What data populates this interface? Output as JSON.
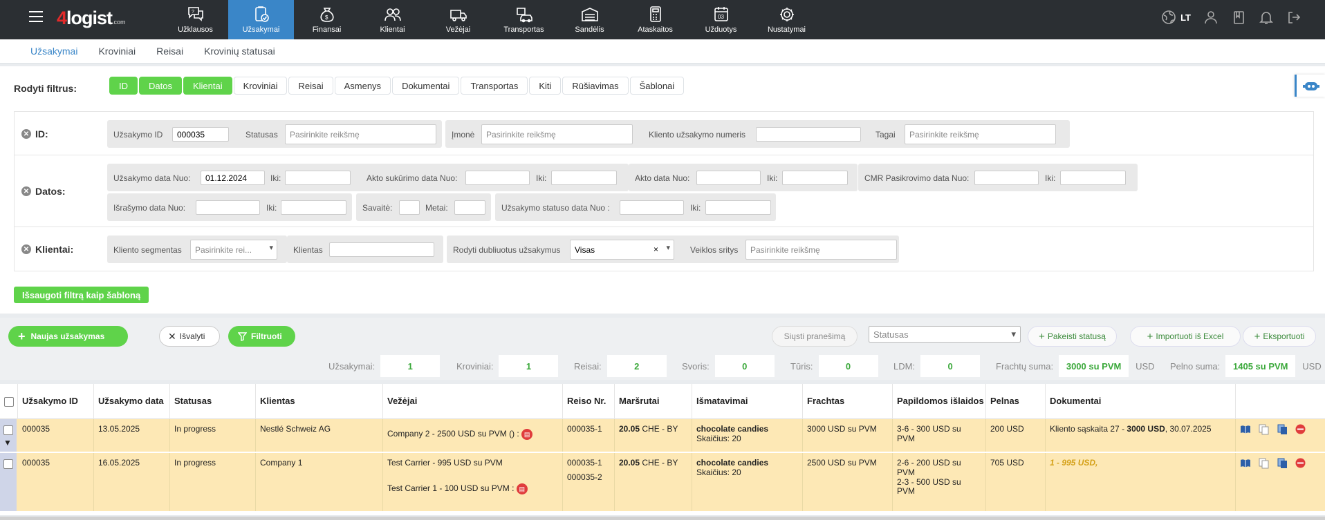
{
  "app": {
    "logo_main": "4",
    "logo_rest": "logist",
    "logo_domain": ".com",
    "language": "LT"
  },
  "nav": [
    {
      "label": "Užklausos",
      "icon": "inquiry-icon"
    },
    {
      "label": "Užsakymai",
      "icon": "orders-icon",
      "active": true
    },
    {
      "label": "Finansai",
      "icon": "money-bag-icon"
    },
    {
      "label": "Klientai",
      "icon": "users-icon"
    },
    {
      "label": "Vežėjai",
      "icon": "truck-icon"
    },
    {
      "label": "Transportas",
      "icon": "vehicles-icon"
    },
    {
      "label": "Sandėlis",
      "icon": "warehouse-icon"
    },
    {
      "label": "Ataskaitos",
      "icon": "calculator-icon"
    },
    {
      "label": "Užduotys",
      "icon": "calendar-icon"
    },
    {
      "label": "Nustatymai",
      "icon": "gear-icon"
    }
  ],
  "subnav": [
    "Užsakymai",
    "Kroviniai",
    "Reisai",
    "Krovinių statusai"
  ],
  "filters": {
    "show_label": "Rodyti filtrus:",
    "tabs": [
      "ID",
      "Datos",
      "Klientai",
      "Kroviniai",
      "Reisai",
      "Asmenys",
      "Dokumentai",
      "Transportas",
      "Kiti",
      "Rūšiavimas",
      "Šablonai"
    ],
    "id_group": {
      "label": "ID:",
      "order_id_label": "Užsakymo ID",
      "order_id_value": "000035",
      "status_label": "Statusas",
      "status_placeholder": "Pasirinkite reikšmę",
      "company_label": "Įmonė",
      "company_placeholder": "Pasirinkite reikšmę",
      "client_order_label": "Kliento užsakymo numeris",
      "tags_label": "Tagai",
      "tags_placeholder": "Pasirinkite reikšmę"
    },
    "dates_group": {
      "label": "Datos:",
      "order_date_label": "Užsakymo data Nuo:",
      "order_date_value": "01.12.2024",
      "to_label": "Iki:",
      "act_created_label": "Akto sukūrimo data Nuo:",
      "act_date_label": "Akto data Nuo:",
      "cmr_label": "CMR Pasikrovimo data Nuo:",
      "issued_label": "Išrašymo data Nuo:",
      "week_label": "Savaitė:",
      "year_label": "Metai:",
      "status_date_label": "Užsakymo statuso data Nuo :"
    },
    "clients_group": {
      "label": "Klientai:",
      "segment_label": "Kliento segmentas",
      "segment_placeholder": "Pasirinkite rei...",
      "client_label": "Klientas",
      "duplicates_label": "Rodyti dubliuotus užsakymus",
      "duplicates_value": "Visas",
      "activity_label": "Veiklos sritys",
      "activity_placeholder": "Pasirinkite reikšmę"
    },
    "save_template": "Išsaugoti filtrą kaip šabloną"
  },
  "actions": {
    "new_order": "Naujas užsakymas",
    "clear": "Išvalyti",
    "filter": "Filtruoti",
    "send_message": "Siųsti pranešimą",
    "status_placeholder": "Statusas",
    "change_status": "Pakeisti statusą",
    "import_excel": "Importuoti iš Excel",
    "export": "Eksportuoti"
  },
  "stats": {
    "orders_label": "Užsakymai:",
    "orders": "1",
    "cargo_label": "Kroviniai:",
    "cargo": "1",
    "trips_label": "Reisai:",
    "trips": "2",
    "weight_label": "Svoris:",
    "weight": "0",
    "volume_label": "Tūris:",
    "volume": "0",
    "ldm_label": "LDM:",
    "ldm": "0",
    "freight_label": "Frachtų suma:",
    "freight": "3000 su PVM",
    "freight_cur": "USD",
    "profit_label": "Pelno suma:",
    "profit": "1405 su PVM",
    "profit_cur": "USD"
  },
  "table": {
    "headers": [
      "Užsakymo ID",
      "Užsakymo data",
      "Statusas",
      "Klientas",
      "Vežėjai",
      "Reiso Nr.",
      "Maršrutai",
      "Išmatavimai",
      "Frachtas",
      "Papildomos išlaidos",
      "Pelnas",
      "Dokumentai"
    ],
    "rows": [
      {
        "id": "000035",
        "date": "13.05.2025",
        "status": "In progress",
        "client": "Nestlé Schweiz AG",
        "carrier1": "Company 2",
        "carrier1_info": " - 2500 USD su PVM () :",
        "trip1": "000035-1",
        "route_bold": "20.05",
        "route": " CHE - BY",
        "goods": "chocolate candies",
        "count": "Skaičius: 20",
        "freight": "3000 USD su PVM",
        "extra": "3-6 - 300 USD su PVM",
        "profit": "200 USD",
        "doc_prefix": "Kliento sąskaita 27 - ",
        "doc_amount": "3000 USD",
        "doc_suffix": ", 30.07.2025"
      },
      {
        "id": "000035",
        "date": "16.05.2025",
        "status": "In progress",
        "client": "Company 1",
        "carrier1": "Test Carrier",
        "carrier1_info": " - 995 USD su PVM",
        "carrier2": "Test Carrier 1",
        "carrier2_info": " - 100 USD su PVM :",
        "trip1": "000035-1",
        "trip2": "000035-2",
        "route_bold": "20.05",
        "route": " CHE - BY",
        "goods": "chocolate candies",
        "count": "Skaičius: 20",
        "freight": "2500 USD su PVM",
        "extra": "2-6 - 200 USD su PVM",
        "extra2": "2-3 - 500 USD su PVM",
        "profit": "705 USD",
        "doc_note": "1 - 995 USD,"
      }
    ]
  },
  "colors": {
    "topbar": "#2b2f33",
    "active_nav": "#3a86c8",
    "green": "#5fd34a",
    "row_bg": "#fde8b5",
    "accent_orange": "#d4a017"
  }
}
